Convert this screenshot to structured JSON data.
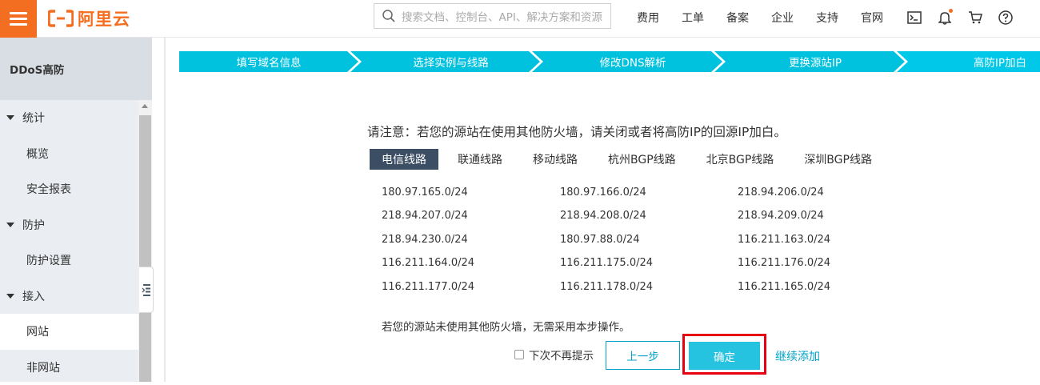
{
  "header": {
    "logo_text": "阿里云",
    "search_placeholder": "搜索文档、控制台、API、解决方案和资源",
    "links": [
      "费用",
      "工单",
      "备案",
      "企业",
      "支持",
      "官网"
    ],
    "icons": [
      "terminal-icon",
      "bell-icon",
      "cart-icon",
      "help-icon"
    ]
  },
  "sidebar": {
    "title": "DDoS高防",
    "groups": [
      {
        "label": "统计",
        "items": [
          "概览",
          "安全报表"
        ]
      },
      {
        "label": "防护",
        "items": [
          "防护设置"
        ]
      },
      {
        "label": "接入",
        "items": [
          "网站",
          "非网站"
        ]
      }
    ],
    "active_item": "网站"
  },
  "steps": [
    "填写域名信息",
    "选择实例与线路",
    "修改DNS解析",
    "更换源站IP",
    "高防IP加白"
  ],
  "notice": "请注意：若您的源站在使用其他防火墙，请关闭或者将高防IP的回源IP加白。",
  "tabs": [
    "电信线路",
    "联通线路",
    "移动线路",
    "杭州BGP线路",
    "北京BGP线路",
    "深圳BGP线路"
  ],
  "active_tab": "电信线路",
  "ip_rows": [
    [
      "180.97.165.0/24",
      "180.97.166.0/24",
      "218.94.206.0/24"
    ],
    [
      "218.94.207.0/24",
      "218.94.208.0/24",
      "218.94.209.0/24"
    ],
    [
      "218.94.230.0/24",
      "180.97.88.0/24",
      "116.211.163.0/24"
    ],
    [
      "116.211.164.0/24",
      "116.211.175.0/24",
      "116.211.176.0/24"
    ],
    [
      "116.211.177.0/24",
      "116.211.178.0/24",
      "116.211.165.0/24"
    ]
  ],
  "hint": "若您的源站未使用其他防火墙，无需采用本步操作。",
  "checkbox_label": "下次不再提示",
  "buttons": {
    "prev": "上一步",
    "confirm": "确定",
    "add_more": "继续添加"
  },
  "colors": {
    "brand": "#f36e21",
    "step": "#00c1de",
    "accent": "#00a2ca",
    "highlight": "#e60012"
  }
}
